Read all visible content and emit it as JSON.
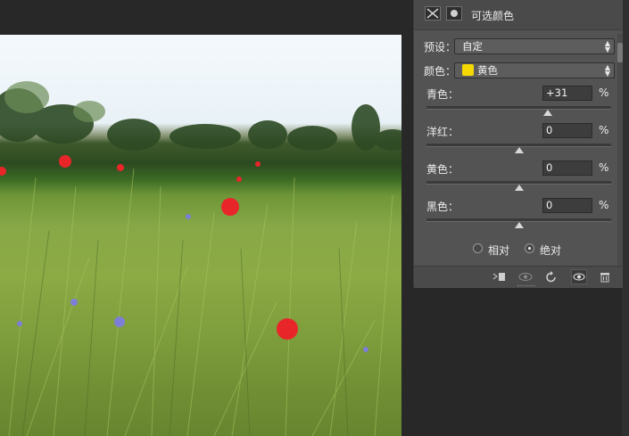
{
  "panel": {
    "title": "可选颜色",
    "preset_label": "预设：",
    "preset_value": "自定",
    "colors_label": "颜色：",
    "colors_value": "黄色",
    "colors_swatch": "#f5d800",
    "sliders": [
      {
        "label": "青色：",
        "value": "+31",
        "unit": "%",
        "level": 0.31
      },
      {
        "label": "洋红：",
        "value": "0",
        "unit": "%",
        "level": 0
      },
      {
        "label": "黄色：",
        "value": "0",
        "unit": "%",
        "level": 0
      },
      {
        "label": "黑色：",
        "value": "0",
        "unit": "%",
        "level": 0
      }
    ],
    "method_relative": "相对",
    "method_absolute": "绝对",
    "method_selected": "绝对"
  },
  "footer_icons": [
    "clip-to-layer-icon",
    "view-previous-icon",
    "reset-icon",
    "visibility-eye-icon",
    "delete-trash-icon"
  ],
  "colors": {
    "panel_bg": "#535353",
    "header_bg": "#4a4a4a",
    "workspace_bg": "#282828"
  }
}
